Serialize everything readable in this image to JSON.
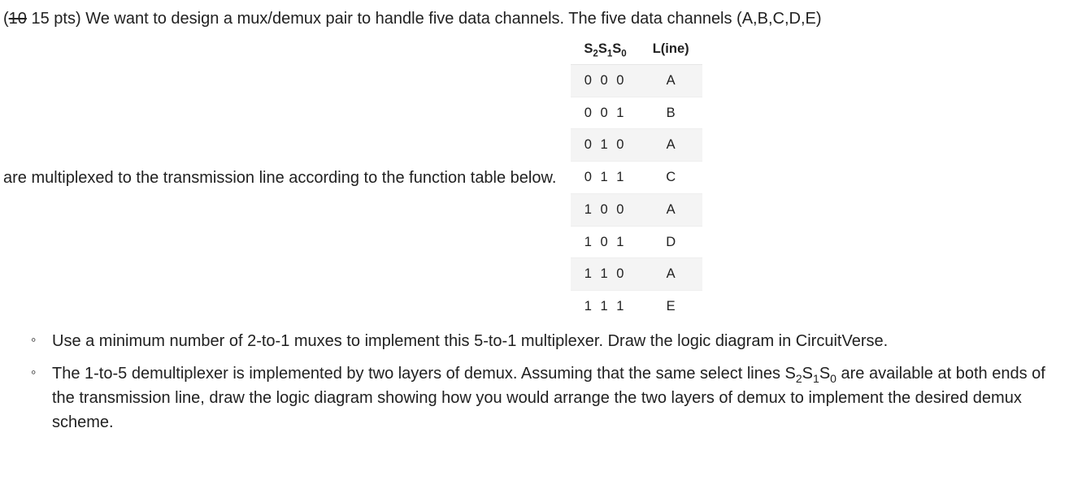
{
  "header": {
    "points_old": "10",
    "points_new": "15",
    "points_label": "pts",
    "text_before": "(",
    "text_after": ") We want to design a mux/demux pair to handle five data channels. The five data channels (A,B,C,D,E)"
  },
  "middle_text": "are multiplexed to the transmission line according to the function table below.",
  "table": {
    "header_select_html": "S<sub>2</sub>S<sub>1</sub>S<sub>0</sub>",
    "header_line": "L(ine)",
    "rows": [
      {
        "sel": "0 0 0",
        "line": "A"
      },
      {
        "sel": "0 0 1",
        "line": "B"
      },
      {
        "sel": "0 1 0",
        "line": "A"
      },
      {
        "sel": "0 1 1",
        "line": "C"
      },
      {
        "sel": "1 0 0",
        "line": "A"
      },
      {
        "sel": "1 0 1",
        "line": "D"
      },
      {
        "sel": "1 1 0",
        "line": "A"
      },
      {
        "sel": "1 1 1",
        "line": "E"
      }
    ]
  },
  "bullets": [
    {
      "html": "Use a minimum number of 2-to-1 muxes to implement this 5-to-1 multiplexer. Draw the logic diagram in CircuitVerse."
    },
    {
      "html": "The 1-to-5 demultiplexer is implemented by two layers of demux. Assuming that the same select lines S<sub>2</sub>S<sub>1</sub>S<sub>0</sub> are available at both ends of the transmission line, draw the logic diagram showing how you would arrange the two layers of demux to implement the desired demux scheme."
    }
  ],
  "chart_data": {
    "type": "table",
    "columns": [
      "S2S1S0",
      "L(ine)"
    ],
    "rows": [
      [
        "0 0 0",
        "A"
      ],
      [
        "0 0 1",
        "B"
      ],
      [
        "0 1 0",
        "A"
      ],
      [
        "0 1 1",
        "C"
      ],
      [
        "1 0 0",
        "A"
      ],
      [
        "1 0 1",
        "D"
      ],
      [
        "1 1 0",
        "A"
      ],
      [
        "1 1 1",
        "E"
      ]
    ]
  }
}
